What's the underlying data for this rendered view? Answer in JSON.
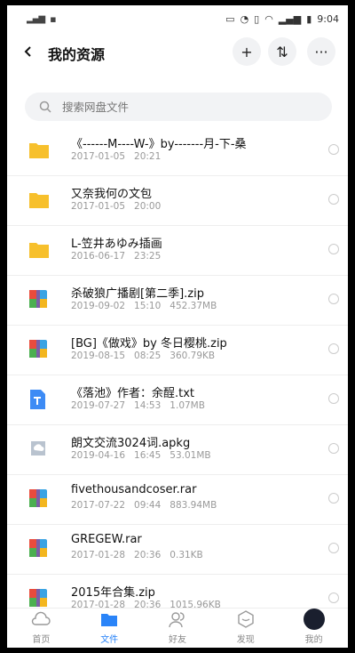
{
  "status_bar": {
    "time": "9:04",
    "battery": "▮"
  },
  "header": {
    "title": "我的资源",
    "add_label": "+",
    "sort_label": "⇅",
    "more_label": "···"
  },
  "search": {
    "placeholder": "搜索网盘文件"
  },
  "files": [
    {
      "type": "folder",
      "name": "《------M----W-》by-------月-下-桑",
      "date": "2017-01-05",
      "time": "20:21",
      "size": ""
    },
    {
      "type": "folder",
      "name": "又奈我何の文包",
      "date": "2017-01-05",
      "time": "20:00",
      "size": ""
    },
    {
      "type": "folder",
      "name": "L-笠井あゆみ插画",
      "date": "2016-06-17",
      "time": "23:25",
      "size": ""
    },
    {
      "type": "zip",
      "name": "杀破狼广播剧[第二季].zip",
      "date": "2019-09-02",
      "time": "15:10",
      "size": "452.37MB"
    },
    {
      "type": "zip",
      "name": "[BG]《做戏》by 冬日樱桃.zip",
      "date": "2019-08-15",
      "time": "08:25",
      "size": "360.79KB"
    },
    {
      "type": "txt",
      "name": "《落池》作者：余酲.txt",
      "date": "2019-07-27",
      "time": "14:53",
      "size": "1.07MB"
    },
    {
      "type": "apkg",
      "name": "朗文交流3024词.apkg",
      "date": "2019-04-16",
      "time": "16:45",
      "size": "53.01MB"
    },
    {
      "type": "zip",
      "name": "fivethousandcoser.rar",
      "date": "2017-07-22",
      "time": "09:44",
      "size": "883.94MB"
    },
    {
      "type": "zip",
      "name": "GREGEW.rar",
      "date": "2017-01-28",
      "time": "20:36",
      "size": "0.31KB"
    },
    {
      "type": "zip",
      "name": "2015年合集.zip",
      "date": "2017-01-28",
      "time": "20:36",
      "size": "1015.96KB"
    }
  ],
  "tabs": [
    {
      "label": "首页",
      "icon": "home-cloud-icon"
    },
    {
      "label": "文件",
      "icon": "folder-icon"
    },
    {
      "label": "好友",
      "icon": "friends-icon"
    },
    {
      "label": "发现",
      "icon": "discover-icon"
    },
    {
      "label": "我的",
      "icon": "avatar-icon"
    }
  ],
  "colors": {
    "accent": "#2a84f8",
    "folder": "#f7c02c"
  }
}
